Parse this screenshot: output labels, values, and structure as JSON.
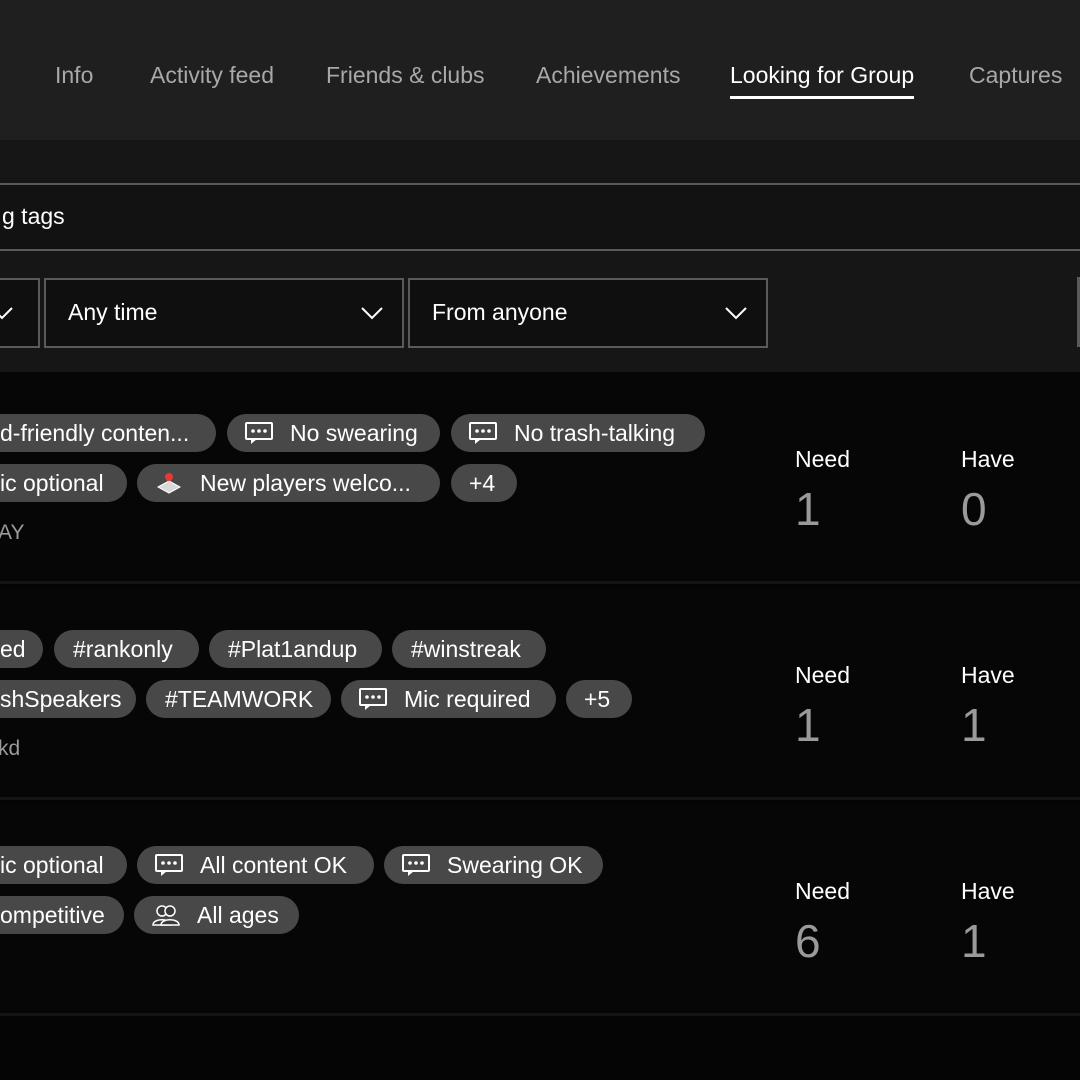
{
  "tabs": [
    {
      "label": "Info"
    },
    {
      "label": "Activity feed"
    },
    {
      "label": "Friends & clubs"
    },
    {
      "label": "Achievements"
    },
    {
      "label": "Looking for Group"
    },
    {
      "label": "Captures"
    }
  ],
  "active_tab": "Looking for Group",
  "search": {
    "text": "g tags"
  },
  "filters": {
    "first_value": "",
    "time": "Any time",
    "from": "From anyone"
  },
  "posts": [
    {
      "tags": [
        "d-friendly conten...",
        "No swearing",
        "No trash-talking",
        "ic optional",
        "New players welco...",
        "+4"
      ],
      "subtitle": "AY",
      "need_label": "Need",
      "need": "1",
      "have_label": "Have",
      "have": "0"
    },
    {
      "tags": [
        "ed",
        "#rankonly",
        "#Plat1andup",
        "#winstreak",
        "shSpeakers",
        "#TEAMWORK",
        "Mic required",
        "+5"
      ],
      "subtitle": "kd",
      "need_label": "Need",
      "need": "1",
      "have_label": "Have",
      "have": "1"
    },
    {
      "tags": [
        "ic optional",
        "All content OK",
        "Swearing OK",
        "ompetitive",
        "All ages"
      ],
      "subtitle": "",
      "need_label": "Need",
      "need": "6",
      "have_label": "Have",
      "have": "1"
    }
  ],
  "icons": {
    "chat": "chat-bubble-icon",
    "joystick": "joystick-icon",
    "people": "people-icon"
  },
  "colors": {
    "topbar": "#1f1f1f",
    "chip": "#484848",
    "joystick_accent": "#e53935"
  }
}
